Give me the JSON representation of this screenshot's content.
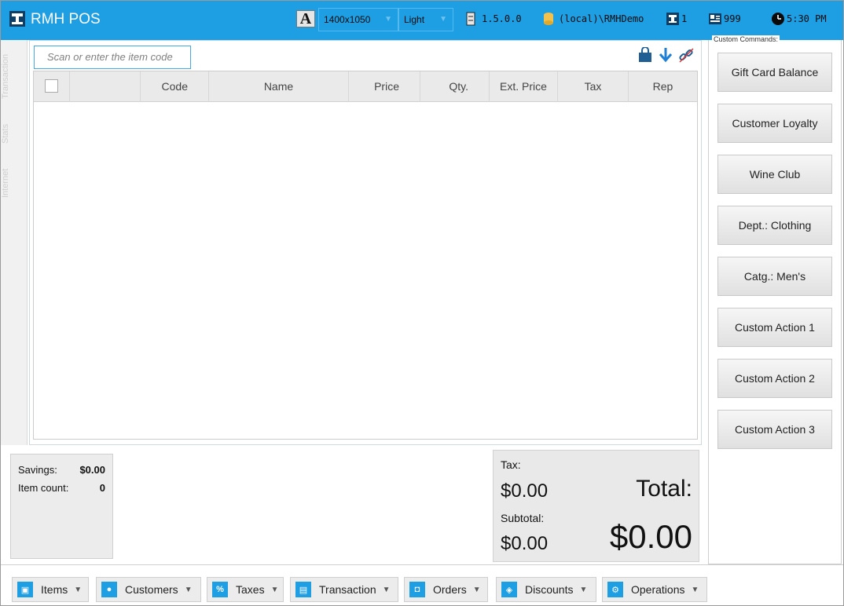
{
  "app": {
    "title": "RMH POS"
  },
  "toolbar": {
    "font_icon_glyph": "A",
    "resolution": "1400x1050",
    "theme": "Light",
    "version": "1.5.0.0",
    "database": "(local)\\RMHDemo",
    "register": "1",
    "cashier": "999",
    "time": "5:30 PM"
  },
  "vertical_tabs": [
    "Transaction",
    "Stats",
    "Internet"
  ],
  "search": {
    "placeholder": "Scan or enter the item code"
  },
  "grid": {
    "columns": [
      "Code",
      "Name",
      "Price",
      "Qty.",
      "Ext. Price",
      "Tax",
      "Rep"
    ],
    "rows": []
  },
  "commands": {
    "legend": "Custom Commands:",
    "buttons": [
      "Gift Card Balance",
      "Customer Loyalty",
      "Wine Club",
      "Dept.: Clothing",
      "Catg.: Men's",
      "Custom Action 1",
      "Custom Action 2",
      "Custom Action 3"
    ]
  },
  "summary": {
    "savings_label": "Savings:",
    "savings_value": "$0.00",
    "item_count_label": "Item count:",
    "item_count_value": "0"
  },
  "totals": {
    "tax_label": "Tax:",
    "tax_value": "$0.00",
    "subtotal_label": "Subtotal:",
    "subtotal_value": "$0.00",
    "total_label": "Total:",
    "total_value": "$0.00"
  },
  "bottom_menu": [
    "Items",
    "Customers",
    "Taxes",
    "Transaction",
    "Orders",
    "Discounts",
    "Operations"
  ],
  "icons": {
    "logo": "register-logo-icon",
    "font": "font-size-icon",
    "version": "server-icon",
    "database": "database-icon",
    "register": "register-icon",
    "cashier": "cashier-icon",
    "clock": "clock-icon"
  },
  "colors": {
    "accent": "#1e9ee3",
    "panel": "#ececec"
  }
}
